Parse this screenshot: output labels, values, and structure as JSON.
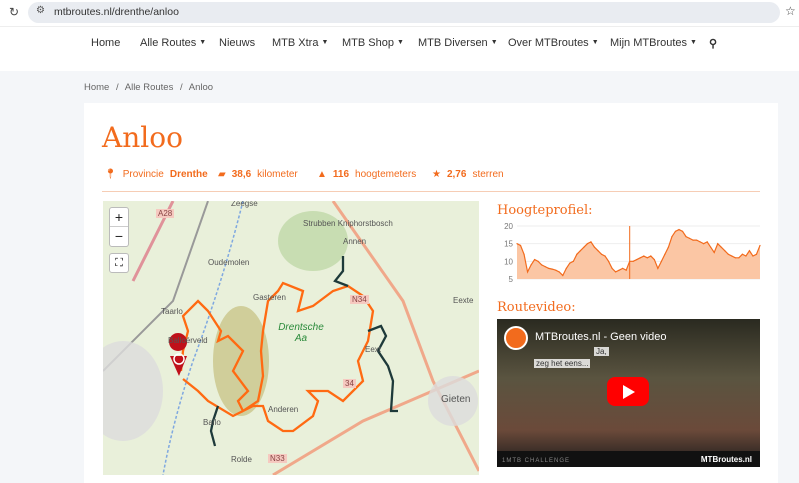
{
  "browser": {
    "url": "mtbroutes.nl/drenthe/anloo"
  },
  "nav": {
    "items": [
      {
        "label": "Home",
        "dropdown": false
      },
      {
        "label": "Alle Routes",
        "dropdown": true
      },
      {
        "label": "Nieuws",
        "dropdown": false
      },
      {
        "label": "MTB Xtra",
        "dropdown": true
      },
      {
        "label": "MTB Shop",
        "dropdown": true
      },
      {
        "label": "MTB Diversen",
        "dropdown": true
      },
      {
        "label": "Over MTBroutes",
        "dropdown": true
      },
      {
        "label": "Mijn MTBroutes",
        "dropdown": true
      }
    ]
  },
  "breadcrumb": {
    "items": [
      "Home",
      "Alle Routes",
      "Anloo"
    ],
    "sep": "/"
  },
  "page": {
    "title": "Anloo",
    "meta": {
      "province_label": "Provincie",
      "province": "Drenthe",
      "distance": "38,6",
      "distance_unit": "kilometer",
      "elevation": "116",
      "elevation_unit": "hoogtemeters",
      "rating": "2,76",
      "rating_unit": "sterren"
    }
  },
  "map": {
    "zoom_in": "+",
    "zoom_out": "−",
    "labels": [
      "Zeegse",
      "A28",
      "Strubben Kniphorstbosch",
      "Annen",
      "Oudemolen",
      "N34",
      "Gasteren",
      "Taarlo",
      "Drentsche Aa",
      "Eext",
      "Balloërveld",
      "34",
      "Gieten",
      "Anderen",
      "Ballo",
      "Rolde",
      "N33",
      "Eexte"
    ]
  },
  "elevation": {
    "title": "Hoogteprofiel:",
    "accent": "#f26b1d",
    "chart_data": {
      "type": "area",
      "ylim": [
        5,
        20
      ],
      "yticks": [
        "20",
        "15",
        "10",
        "5"
      ],
      "values": [
        15,
        14.5,
        12,
        7,
        9,
        10.5,
        10,
        9,
        8.5,
        8,
        7.8,
        7.5,
        7,
        6,
        8,
        9.5,
        10,
        12,
        13,
        14,
        15,
        15.5,
        14,
        13,
        12,
        11.5,
        10,
        8,
        7,
        7.5,
        8,
        7.5,
        10,
        10,
        10.5,
        11,
        11.5,
        11,
        11.5,
        10.5,
        8,
        10,
        12,
        14,
        17,
        18.5,
        19,
        18.5,
        17,
        16.5,
        16,
        16,
        15.5,
        15,
        15.5,
        14,
        12.5,
        15,
        14,
        13,
        12,
        11.5,
        11,
        11,
        12,
        11.5,
        13,
        11.5,
        12,
        14.5
      ],
      "marker_index": 32
    }
  },
  "video": {
    "title": "Routevideo:",
    "video_title": "MTBroutes.nl - Geen video",
    "caption1": "Ja,",
    "caption2": "zeg het eens...",
    "footer": "1MTB CHALLENGE",
    "brand": "MTBroutes.nl"
  }
}
